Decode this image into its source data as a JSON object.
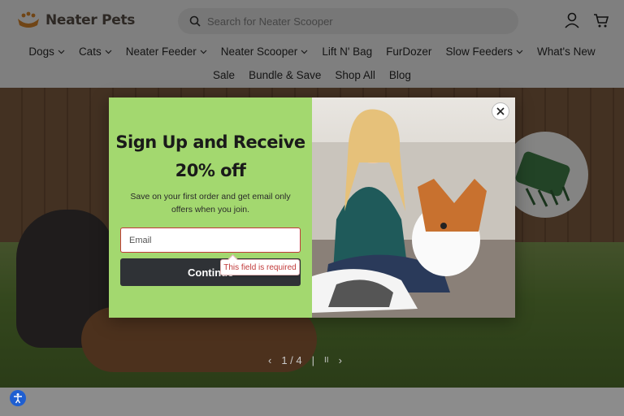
{
  "brand": {
    "name": "Neater Pets",
    "accent": "#e08a2c"
  },
  "search": {
    "placeholder": "Search for Neater Scooper"
  },
  "header_icons": {
    "account": "user-icon",
    "cart": "cart-icon"
  },
  "nav": {
    "row1": [
      {
        "label": "Dogs",
        "dropdown": true
      },
      {
        "label": "Cats",
        "dropdown": true
      },
      {
        "label": "Neater Feeder",
        "dropdown": true
      },
      {
        "label": "Neater Scooper",
        "dropdown": true
      },
      {
        "label": "Lift N' Bag",
        "dropdown": false
      },
      {
        "label": "FurDozer",
        "dropdown": false
      },
      {
        "label": "Slow Feeders",
        "dropdown": true
      },
      {
        "label": "What's New",
        "dropdown": false
      }
    ],
    "row2": [
      {
        "label": "Sale"
      },
      {
        "label": "Bundle & Save"
      },
      {
        "label": "Shop All"
      },
      {
        "label": "Blog"
      }
    ]
  },
  "slider": {
    "counter": "1 / 4",
    "prev": "‹",
    "next": "›",
    "pause": "II"
  },
  "popup": {
    "headline_line1": "Sign Up and Receive",
    "headline_line2": "20% off",
    "subtext": "Save on your first order and get email only offers when you join.",
    "email_placeholder": "Email",
    "button_label": "Continue",
    "error_message": "This field is required",
    "background_color": "#a3d86f",
    "button_color": "#2f3236"
  }
}
